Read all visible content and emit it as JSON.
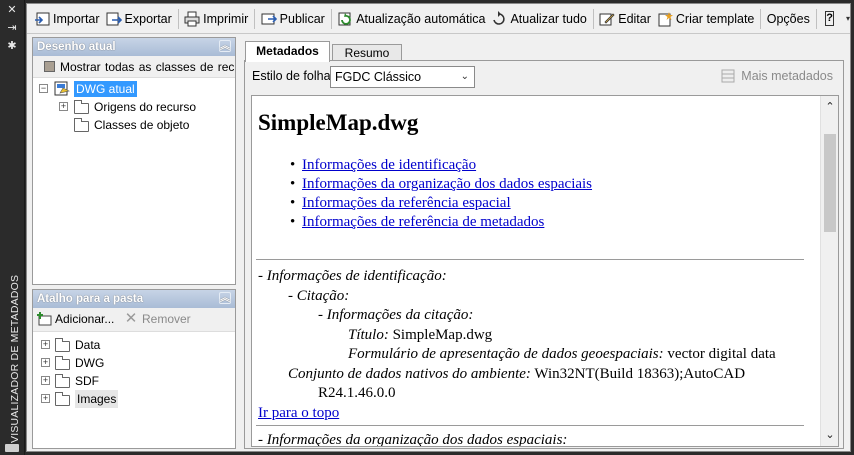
{
  "sidebar_vertical": {
    "title": "VISUALIZADOR DE METADADOS"
  },
  "toolbar": {
    "importar": "Importar",
    "exportar": "Exportar",
    "imprimir": "Imprimir",
    "publicar": "Publicar",
    "atualizacao_auto": "Atualização automática",
    "atualizar_tudo": "Atualizar tudo",
    "editar": "Editar",
    "criar_template": "Criar template",
    "opcoes": "Opções",
    "help": "?"
  },
  "desenho_panel": {
    "title": "Desenho atual",
    "show_all": "Mostrar todas as classes de rec",
    "tree": {
      "root": "DWG atual",
      "children": [
        "Origens do recurso",
        "Classes de objeto"
      ]
    }
  },
  "atalho_panel": {
    "title": "Atalho para a pasta",
    "add": "Adicionar...",
    "remove": "Remover",
    "folders": [
      "Data",
      "DWG",
      "SDF",
      "Images"
    ]
  },
  "tabs": {
    "metadados": "Metadados",
    "resumo": "Resumo"
  },
  "style": {
    "label": "Estilo de folha:",
    "value": "FGDC Clássico",
    "more": "Mais metadados"
  },
  "document": {
    "title": "SimpleMap.dwg",
    "links": [
      "Informações de identificação",
      "Informações da organização dos dados espaciais",
      "Informações da referência espacial",
      "Informações de referência de metadados"
    ],
    "section1": {
      "heading": "- Informações de identificação:",
      "citacao": "- Citação:",
      "info_citacao": "- Informações da citação:",
      "titulo_label": "Título:",
      "titulo_value": "SimpleMap.dwg",
      "form_label": "Formulário de apresentação de dados geoespaciais:",
      "form_value": "vector digital data",
      "conj_label": "Conjunto de dados nativos do ambiente:",
      "conj_value": "Win32NT(Build 18363);AutoCAD",
      "conj_value2": "R24.1.46.0.0",
      "top_link": "Ir para o topo"
    },
    "section2": {
      "heading": "- Informações da organização dos dados espaciais:"
    }
  },
  "colors": {
    "panel_header": "#b8c8de",
    "link": "#0000cc",
    "selected": "#3399ff"
  }
}
